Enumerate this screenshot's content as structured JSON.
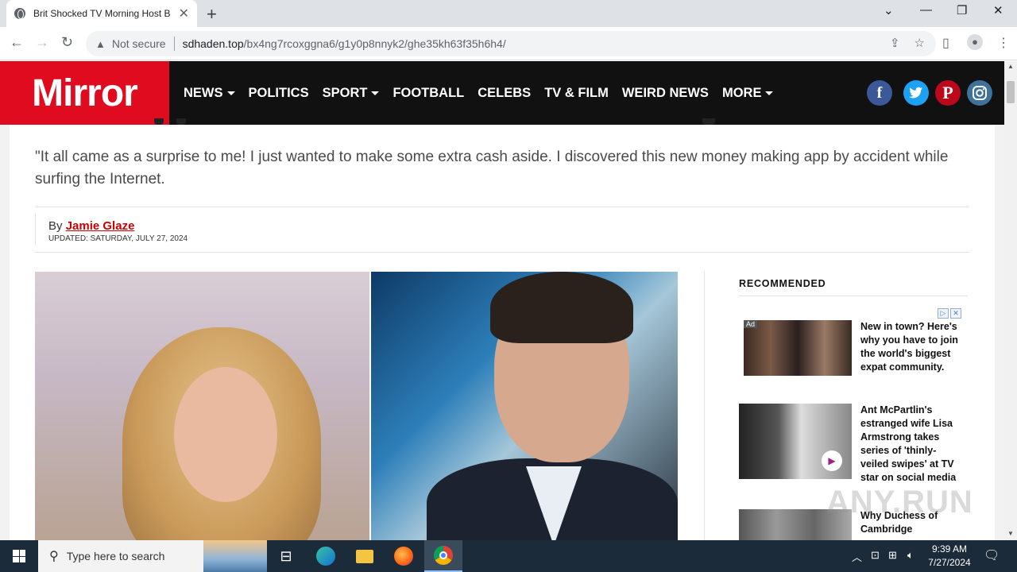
{
  "browser": {
    "tab_title": "Brit Shocked TV Morning Host B",
    "security_label": "Not secure",
    "url_host": "sdhaden.top",
    "url_path": "/bx4ng7rcoxggna6/g1y0p8nnyk2/ghe35kh63f35h6h4/"
  },
  "site": {
    "logo": "Mirror",
    "nav": [
      "NEWS",
      "POLITICS",
      "SPORT",
      "FOOTBALL",
      "CELEBS",
      "TV & FILM",
      "WEIRD NEWS",
      "MORE"
    ],
    "social": {
      "facebook": "f",
      "twitter": "t",
      "pinterest": "p",
      "instagram": "ig"
    },
    "colors": {
      "brand_red": "#e00b1e",
      "facebook": "#3b5998",
      "twitter": "#1da1f2",
      "pinterest": "#bd081c",
      "instagram": "#3f729b"
    }
  },
  "article": {
    "lede": "\"It all came as a surprise to me! I just wanted to make some extra cash aside. I discovered this new money making app by accident while surfing the Internet.",
    "by_prefix": "By ",
    "author": "Jamie Glaze",
    "updated": "UPDATED: SATURDAY, JULY 27, 2024"
  },
  "sidebar": {
    "heading": "RECOMMENDED",
    "ad_label": "Ad",
    "items": [
      {
        "text": "New in town? Here's why you have to join the world's biggest expat community."
      },
      {
        "text": "Ant McPartlin's estranged wife Lisa Armstrong takes series of 'thinly-veiled swipes' at TV star on social media"
      },
      {
        "text": "Why Duchess of Cambridge"
      }
    ]
  },
  "watermark": "ANY.RUN",
  "taskbar": {
    "search_placeholder": "Type here to search",
    "time": "9:39 AM",
    "date": "7/27/2024"
  }
}
